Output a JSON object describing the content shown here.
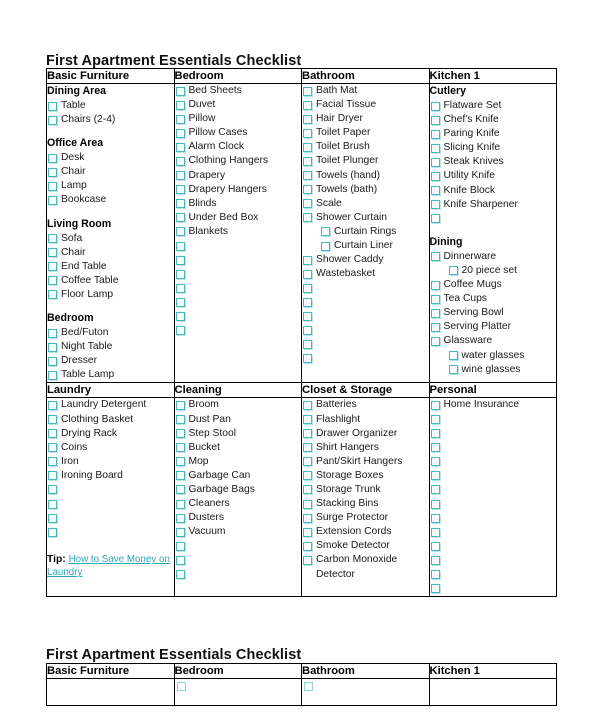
{
  "document": {
    "title_top": "First Apartment Essentials Checklist",
    "title_bottom": "First Apartment Essentials Checklist"
  },
  "theme": {
    "checkbox_color": "#3fb9bd",
    "link_color": "#2aa8ba",
    "border_color": "#000000",
    "text_color": "#1a1a1a",
    "background": "#ffffff"
  },
  "table_main": {
    "row1": {
      "headers": [
        "Basic Furniture",
        "Bedroom",
        "Bathroom",
        "Kitchen 1"
      ],
      "columns": [
        {
          "header": "Basic Furniture",
          "entries": [
            {
              "type": "group",
              "label": "Dining Area"
            },
            {
              "type": "item",
              "label": "Table"
            },
            {
              "type": "item",
              "label": "Chairs (2-4)"
            },
            {
              "type": "spacer"
            },
            {
              "type": "group",
              "label": "Office Area"
            },
            {
              "type": "item",
              "label": "Desk"
            },
            {
              "type": "item",
              "label": "Chair"
            },
            {
              "type": "item",
              "label": "Lamp"
            },
            {
              "type": "item",
              "label": "Bookcase"
            },
            {
              "type": "spacer"
            },
            {
              "type": "group",
              "label": "Living Room"
            },
            {
              "type": "item",
              "label": "Sofa"
            },
            {
              "type": "item",
              "label": "Chair"
            },
            {
              "type": "item",
              "label": "End Table"
            },
            {
              "type": "item",
              "label": "Coffee Table"
            },
            {
              "type": "item",
              "label": "Floor Lamp"
            },
            {
              "type": "spacer"
            },
            {
              "type": "group",
              "label": "Bedroom"
            },
            {
              "type": "item",
              "label": "Bed/Futon"
            },
            {
              "type": "item",
              "label": "Night Table"
            },
            {
              "type": "item",
              "label": "Dresser"
            },
            {
              "type": "item",
              "label": "Table Lamp"
            }
          ]
        },
        {
          "header": "Bedroom",
          "entries": [
            {
              "type": "item",
              "label": "Bed Sheets"
            },
            {
              "type": "item",
              "label": "Duvet"
            },
            {
              "type": "item",
              "label": "Pillow"
            },
            {
              "type": "item",
              "label": "Pillow Cases"
            },
            {
              "type": "item",
              "label": "Alarm Clock"
            },
            {
              "type": "item",
              "label": "Clothing Hangers"
            },
            {
              "type": "item",
              "label": "Drapery"
            },
            {
              "type": "item",
              "label": "Drapery Hangers"
            },
            {
              "type": "item",
              "label": "Blinds"
            },
            {
              "type": "item",
              "label": "Under Bed Box"
            },
            {
              "type": "item",
              "label": "Blankets"
            },
            {
              "type": "item",
              "label": ""
            },
            {
              "type": "item",
              "label": ""
            },
            {
              "type": "item",
              "label": ""
            },
            {
              "type": "item",
              "label": ""
            },
            {
              "type": "item",
              "label": ""
            },
            {
              "type": "item",
              "label": ""
            },
            {
              "type": "item",
              "label": ""
            }
          ]
        },
        {
          "header": "Bathroom",
          "entries": [
            {
              "type": "item",
              "label": "Bath Mat"
            },
            {
              "type": "item",
              "label": "Facial Tissue"
            },
            {
              "type": "item",
              "label": "Hair Dryer"
            },
            {
              "type": "item",
              "label": "Toilet Paper"
            },
            {
              "type": "item",
              "label": "Toilet Brush"
            },
            {
              "type": "item",
              "label": "Toilet Plunger"
            },
            {
              "type": "item",
              "label": "Towels (hand)"
            },
            {
              "type": "item",
              "label": "Towels (bath)"
            },
            {
              "type": "item",
              "label": "Scale"
            },
            {
              "type": "item",
              "label": "Shower Curtain"
            },
            {
              "type": "sub",
              "label": "Curtain Rings"
            },
            {
              "type": "sub",
              "label": "Curtain Liner"
            },
            {
              "type": "item",
              "label": "Shower Caddy"
            },
            {
              "type": "item",
              "label": "Wastebasket"
            },
            {
              "type": "item",
              "label": ""
            },
            {
              "type": "item",
              "label": ""
            },
            {
              "type": "item",
              "label": ""
            },
            {
              "type": "item",
              "label": ""
            },
            {
              "type": "item",
              "label": ""
            },
            {
              "type": "item",
              "label": ""
            }
          ]
        },
        {
          "header": "Kitchen 1",
          "entries": [
            {
              "type": "group",
              "label": "Cutlery"
            },
            {
              "type": "item",
              "label": "Flatware Set"
            },
            {
              "type": "item",
              "label": "Chef's Knife"
            },
            {
              "type": "item",
              "label": "Paring Knife"
            },
            {
              "type": "item",
              "label": "Slicing Knife"
            },
            {
              "type": "item",
              "label": "Steak Knives"
            },
            {
              "type": "item",
              "label": "Utility Knife"
            },
            {
              "type": "item",
              "label": "Knife Block"
            },
            {
              "type": "item",
              "label": "Knife Sharpener"
            },
            {
              "type": "item",
              "label": ""
            },
            {
              "type": "spacer"
            },
            {
              "type": "group",
              "label": "Dining"
            },
            {
              "type": "item",
              "label": "Dinnerware"
            },
            {
              "type": "sub",
              "label": "20 piece set"
            },
            {
              "type": "item",
              "label": "Coffee Mugs"
            },
            {
              "type": "item",
              "label": "Tea Cups"
            },
            {
              "type": "item",
              "label": "Serving Bowl"
            },
            {
              "type": "item",
              "label": "Serving Platter"
            },
            {
              "type": "item",
              "label": "Glassware"
            },
            {
              "type": "sub",
              "label": "water glasses"
            },
            {
              "type": "sub",
              "label": "wine glasses"
            }
          ]
        }
      ]
    },
    "row2": {
      "headers": [
        "Laundry",
        "Cleaning",
        "Closet & Storage",
        "Personal"
      ],
      "columns": [
        {
          "header": "Laundry",
          "entries": [
            {
              "type": "item",
              "label": "Laundry Detergent"
            },
            {
              "type": "item",
              "label": "Clothing Basket"
            },
            {
              "type": "item",
              "label": "Drying Rack"
            },
            {
              "type": "item",
              "label": "Coins"
            },
            {
              "type": "item",
              "label": "Iron"
            },
            {
              "type": "item",
              "label": "Ironing Board"
            },
            {
              "type": "item",
              "label": ""
            },
            {
              "type": "item",
              "label": ""
            },
            {
              "type": "item",
              "label": ""
            },
            {
              "type": "item",
              "label": ""
            }
          ],
          "tip": {
            "label": "Tip:",
            "link_text": "How to Save Money on Laundry"
          }
        },
        {
          "header": "Cleaning",
          "entries": [
            {
              "type": "item",
              "label": "Broom"
            },
            {
              "type": "item",
              "label": "Dust Pan"
            },
            {
              "type": "item",
              "label": "Step Stool"
            },
            {
              "type": "item",
              "label": "Bucket"
            },
            {
              "type": "item",
              "label": "Mop"
            },
            {
              "type": "item",
              "label": "Garbage Can"
            },
            {
              "type": "item",
              "label": "Garbage Bags"
            },
            {
              "type": "item",
              "label": "Cleaners"
            },
            {
              "type": "item",
              "label": "Dusters"
            },
            {
              "type": "item",
              "label": "Vacuum"
            },
            {
              "type": "item",
              "label": ""
            },
            {
              "type": "item",
              "label": ""
            },
            {
              "type": "item",
              "label": ""
            }
          ]
        },
        {
          "header": "Closet & Storage",
          "entries": [
            {
              "type": "item",
              "label": "Batteries"
            },
            {
              "type": "item",
              "label": "Flashlight"
            },
            {
              "type": "item",
              "label": "Drawer Organizer"
            },
            {
              "type": "item",
              "label": "Shirt Hangers"
            },
            {
              "type": "item",
              "label": "Pant/Skirt Hangers"
            },
            {
              "type": "item",
              "label": "Storage Boxes"
            },
            {
              "type": "item",
              "label": "Storage Trunk"
            },
            {
              "type": "item",
              "label": "Stacking Bins"
            },
            {
              "type": "item",
              "label": "Surge Protector"
            },
            {
              "type": "item",
              "label": "Extension Cords"
            },
            {
              "type": "item",
              "label": "Smoke Detector"
            },
            {
              "type": "wrap",
              "label": "Carbon Monoxide Detector"
            }
          ]
        },
        {
          "header": "Personal",
          "entries": [
            {
              "type": "item",
              "label": "Home Insurance"
            },
            {
              "type": "item",
              "label": ""
            },
            {
              "type": "item",
              "label": ""
            },
            {
              "type": "item",
              "label": ""
            },
            {
              "type": "item",
              "label": ""
            },
            {
              "type": "item",
              "label": ""
            },
            {
              "type": "item",
              "label": ""
            },
            {
              "type": "item",
              "label": ""
            },
            {
              "type": "item",
              "label": ""
            },
            {
              "type": "item",
              "label": ""
            },
            {
              "type": "item",
              "label": ""
            },
            {
              "type": "item",
              "label": ""
            },
            {
              "type": "item",
              "label": ""
            },
            {
              "type": "item",
              "label": ""
            }
          ]
        }
      ]
    }
  },
  "table_bottom": {
    "headers": [
      "Basic Furniture",
      "Bedroom",
      "Bathroom",
      "Kitchen 1"
    ],
    "stub_checkboxes": [
      false,
      true,
      true,
      false
    ]
  }
}
